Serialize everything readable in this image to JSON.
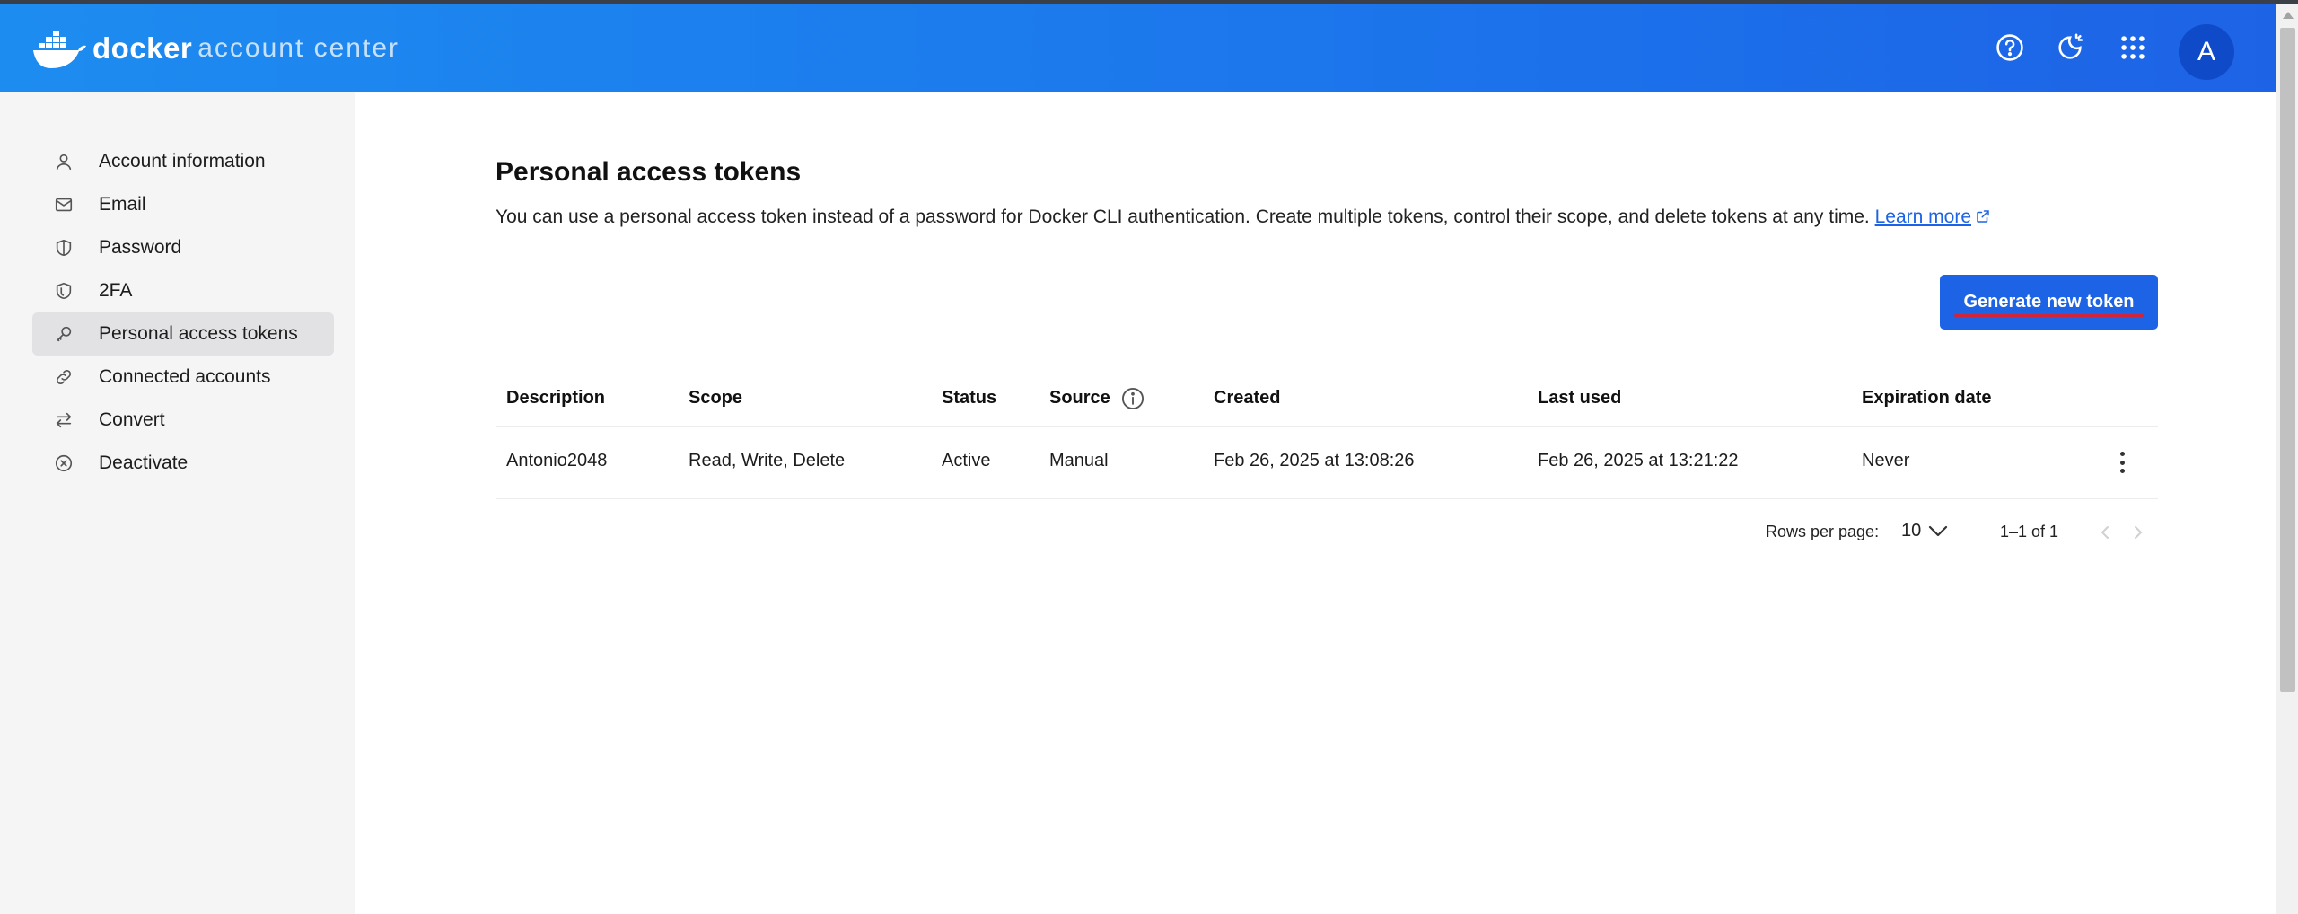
{
  "header": {
    "logo_word": "docker",
    "logo_subtitle": "account center",
    "avatar_initial": "A",
    "icons": [
      "help-icon",
      "theme-toggle-icon",
      "apps-grid-icon"
    ]
  },
  "sidebar": {
    "items": [
      {
        "label": "Account information",
        "icon": "user-icon",
        "active": false
      },
      {
        "label": "Email",
        "icon": "mail-icon",
        "active": false
      },
      {
        "label": "Password",
        "icon": "shield-icon",
        "active": false
      },
      {
        "label": "2FA",
        "icon": "shield-check-icon",
        "active": false
      },
      {
        "label": "Personal access tokens",
        "icon": "key-icon",
        "active": true
      },
      {
        "label": "Connected accounts",
        "icon": "link-icon",
        "active": false
      },
      {
        "label": "Convert",
        "icon": "swap-icon",
        "active": false
      },
      {
        "label": "Deactivate",
        "icon": "x-circle-icon",
        "active": false
      }
    ]
  },
  "main": {
    "title": "Personal access tokens",
    "description": "You can use a personal access token instead of a password for Docker CLI authentication. Create multiple tokens, control their scope, and delete tokens at any time.",
    "learn_more": "Learn more",
    "generate_button": "Generate new token"
  },
  "table": {
    "columns": [
      "Description",
      "Scope",
      "Status",
      "Source",
      "Created",
      "Last used",
      "Expiration date"
    ],
    "rows": [
      [
        "Antonio2048",
        "Read, Write, Delete",
        "Active",
        "Manual",
        "Feb 26, 2025 at 13:08:26",
        "Feb 26, 2025 at 13:21:22",
        "Never"
      ]
    ]
  },
  "pagination": {
    "rows_per_page_label": "Rows per page:",
    "rows_per_page_value": "10",
    "range_label": "1–1 of 1"
  },
  "colors": {
    "accent": "#1d63e6",
    "header_start": "#1d8cf0",
    "header_end": "#1d63e6",
    "sidebar_bg": "#f5f5f5",
    "active_item_bg": "#e2e2e4",
    "annotation_underline": "#d1233a"
  }
}
